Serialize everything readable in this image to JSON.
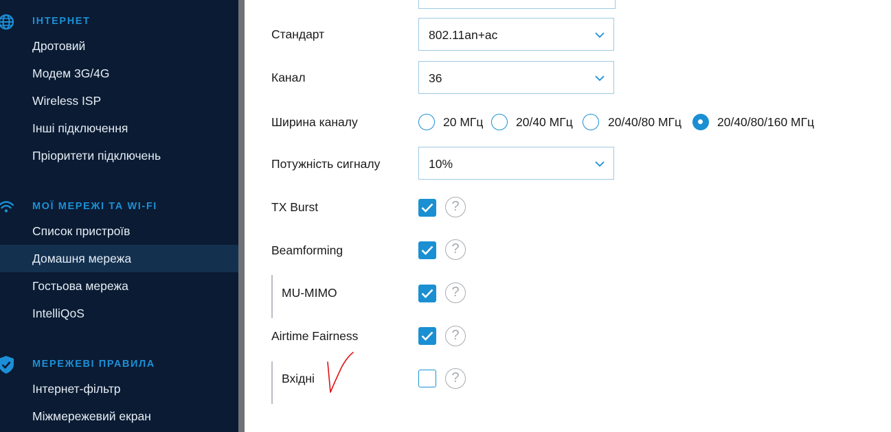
{
  "sidebar": {
    "sections": [
      {
        "title": "ІНТЕРНЕТ",
        "icon": "globe-icon",
        "items": [
          "Дротовий",
          "Модем 3G/4G",
          "Wireless ISP",
          "Інші підключення",
          "Пріоритети підключень"
        ]
      },
      {
        "title": "МОЇ МЕРЕЖІ ТА WI-FI",
        "icon": "wifi-icon",
        "items": [
          "Список пристроїв",
          "Домашня мережа",
          "Гостьова мережа",
          "IntelliQoS"
        ]
      },
      {
        "title": "МЕРЕЖЕВІ ПРАВИЛА",
        "icon": "shield-icon",
        "items": [
          "Інтернет-фільтр",
          "Міжмережевий екран"
        ]
      }
    ],
    "active_item": "Домашня мережа"
  },
  "form": {
    "standard": {
      "label": "Стандарт",
      "value": "802.11an+ac"
    },
    "channel": {
      "label": "Канал",
      "value": "36"
    },
    "bandwidth": {
      "label": "Ширина каналу",
      "options": [
        "20 МГц",
        "20/40 МГц",
        "20/40/80 МГц",
        "20/40/80/160 МГц"
      ],
      "selected": "20/40/80/160 МГц"
    },
    "tx_power": {
      "label": "Потужність сигналу",
      "value": "10%"
    },
    "tx_burst": {
      "label": "TX Burst",
      "checked": true
    },
    "beamforming": {
      "label": "Beamforming",
      "checked": true
    },
    "mu_mimo": {
      "label": "MU-MIMO",
      "checked": true
    },
    "airtime_fairness": {
      "label": "Airtime Fairness",
      "checked": true
    },
    "inbound": {
      "label": "Вхідні",
      "checked": false
    },
    "help_glyph": "?"
  },
  "colors": {
    "sidebar_bg": "#0a1b33",
    "section_title": "#1d8fd6",
    "active_item_bg": "#13304f",
    "accent": "#1a8fd2",
    "annotation": "#e01010"
  }
}
